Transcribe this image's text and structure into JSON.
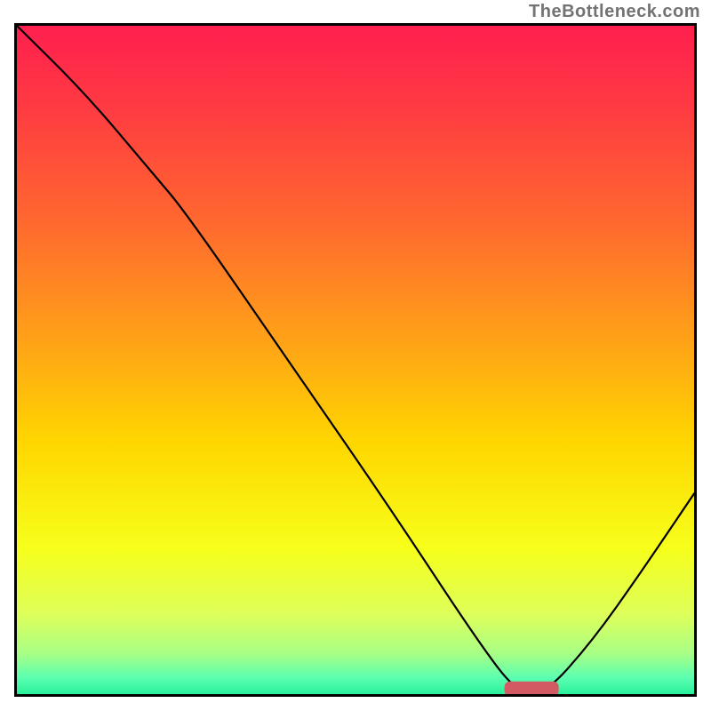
{
  "watermark": "TheBottleneck.com",
  "chart_data": {
    "type": "line",
    "title": "",
    "xlabel": "",
    "ylabel": "",
    "xlim": [
      0,
      100
    ],
    "ylim": [
      0,
      100
    ],
    "series": [
      {
        "name": "bottleneck-curve",
        "x": [
          0,
          10,
          20,
          25,
          40,
          55,
          68,
          74,
          78,
          85,
          92,
          100
        ],
        "y": [
          100,
          90,
          78,
          72,
          50,
          28,
          8,
          0,
          0,
          8,
          18,
          30
        ]
      }
    ],
    "marker": {
      "x": 76,
      "y": 0.8,
      "w": 8,
      "h": 2.2,
      "color": "#d15a63"
    },
    "gradient_stops": [
      {
        "offset": 0.0,
        "color": "#ff1f4f"
      },
      {
        "offset": 0.12,
        "color": "#ff3a42"
      },
      {
        "offset": 0.3,
        "color": "#ff6a2e"
      },
      {
        "offset": 0.48,
        "color": "#ffa516"
      },
      {
        "offset": 0.62,
        "color": "#ffd500"
      },
      {
        "offset": 0.78,
        "color": "#f7ff1a"
      },
      {
        "offset": 0.88,
        "color": "#deff5a"
      },
      {
        "offset": 0.94,
        "color": "#a7ff86"
      },
      {
        "offset": 0.975,
        "color": "#5cffb0"
      },
      {
        "offset": 1.0,
        "color": "#29f09c"
      }
    ]
  }
}
